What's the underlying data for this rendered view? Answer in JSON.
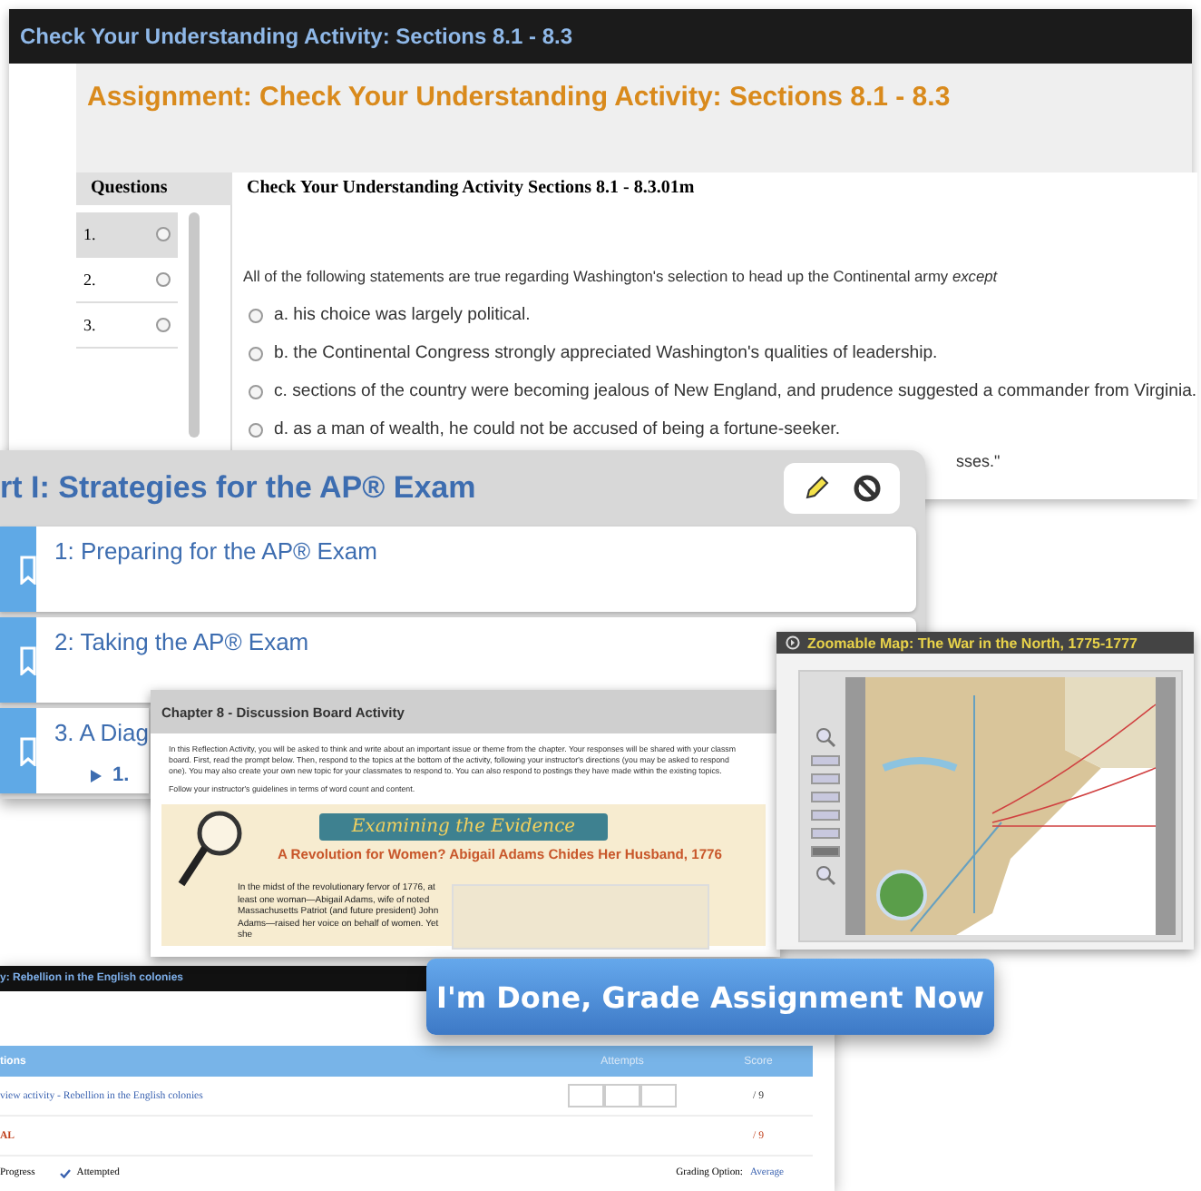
{
  "quiz_window": {
    "title": "Check Your Understanding Activity: Sections 8.1 - 8.3",
    "heading": "Assignment: Check Your Understanding Activity: Sections 8.1 - 8.3",
    "questions_header": "Questions",
    "activity_title": "Check Your Understanding Activity Sections 8.1 - 8.3.01m",
    "questions": [
      {
        "number": "1.",
        "selected": true
      },
      {
        "number": "2.",
        "selected": false
      },
      {
        "number": "3.",
        "selected": false
      }
    ],
    "prompt": "All of the following statements are true regarding Washington's selection to head up the Continental army *except*",
    "options": [
      {
        "text": "a. his choice was largely political.",
        "checked": false
      },
      {
        "text": "b. the Continental Congress strongly appreciated Washington's qualities of leadership.",
        "checked": false
      },
      {
        "text": "c. sections of the country were becoming jealous of New England, and prudence suggested a commander from Virginia.",
        "checked": false
      },
      {
        "text": "d. as a man of wealth, he could not be accused of being a fortune-seeker.",
        "checked": false
      }
    ],
    "covered_option_tail": "sses.\""
  },
  "units_window": {
    "title": "rt I: Strategies for the AP® Exam",
    "items": [
      {
        "label": "1: Preparing for the AP® Exam"
      },
      {
        "label": "2: Taking the AP® Exam"
      },
      {
        "label": "3. A Diag",
        "children": [
          {
            "label": "1."
          }
        ]
      }
    ]
  },
  "gradebook_window": {
    "title": "y: Rebellion in the English colonies",
    "columns": [
      "tions",
      "Attempts",
      "Score"
    ],
    "rows": [
      {
        "kind": "activity",
        "name": "view activity - Rebellion in the English colonies",
        "score": "/ 9"
      },
      {
        "kind": "total",
        "name": "AL",
        "score": "/ 9"
      }
    ],
    "legend": [
      "Progress",
      "Attempted"
    ],
    "grading_label": "Grading Option:",
    "grading_value": "Average"
  },
  "discussion_window": {
    "title": "Chapter 8 - Discussion Board Activity",
    "paragraphs": [
      "In this Reflection Activity, you will be asked to think and write about an important issue or theme from the chapter.  Your responses will be shared with your classm",
      "board.  First, read the prompt below.  Then, respond to the topics at the bottom of the activity, following your instructor's directions (you may be asked to respond",
      "one).  You may also create your own new topic for your classmates to respond to.  You can also respond to  postings they have made within the existing topics.",
      "Follow your instructor's guidelines in terms of word count and content."
    ],
    "feature": {
      "banner": "Examining the Evidence",
      "headline": "A Revolution for Women? Abigail Adams Chides Her Husband, 1776",
      "body": "In the midst of the revolutionary fervor of 1776, at least one woman—Abigail Adams, wife of noted Massachusetts Patriot (and future president) John Adams—raised her voice on behalf of women. Yet she"
    }
  },
  "map_window": {
    "title": "Zoomable Map: The War in the North, 1775-1777",
    "zoom_steps": [
      {
        "selected": false
      },
      {
        "selected": false
      },
      {
        "selected": false
      },
      {
        "selected": false
      },
      {
        "selected": false
      },
      {
        "selected": true
      }
    ]
  },
  "grade_button": {
    "label": "I'm Done, Grade Assignment Now"
  }
}
